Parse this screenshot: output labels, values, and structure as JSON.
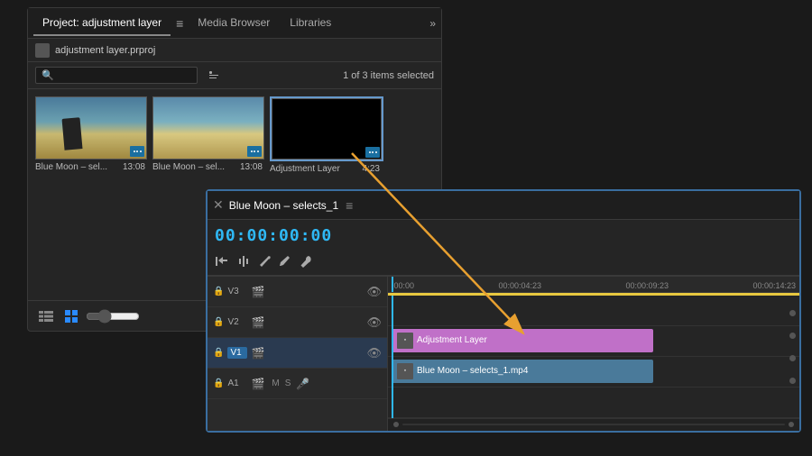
{
  "projectPanel": {
    "tabs": [
      {
        "label": "Project: adjustment layer",
        "active": true
      },
      {
        "label": "Media Browser",
        "active": false
      },
      {
        "label": "Libraries",
        "active": false
      }
    ],
    "moreLabel": "»",
    "menuIcon": "≡",
    "filename": "adjustment layer.prproj",
    "searchPlaceholder": "",
    "selectionInfo": "1 of 3 items selected",
    "mediaItems": [
      {
        "label": "Blue Moon – sel...",
        "duration": "13:08"
      },
      {
        "label": "Blue Moon – sel...",
        "duration": "13:08"
      },
      {
        "label": "Adjustment Layer",
        "duration": "4:23"
      }
    ],
    "bottomIcons": [
      "list-icon",
      "grid-icon",
      "zoom-icon",
      "expand-icon"
    ]
  },
  "timelinePanel": {
    "closeLabel": "✕",
    "tabLabel": "Blue Moon – selects_1",
    "menuIcon": "≡",
    "timecode": "00:00:00:00",
    "tracks": [
      {
        "label": "V3",
        "active": false
      },
      {
        "label": "V2",
        "active": false
      },
      {
        "label": "V1",
        "active": true
      },
      {
        "label": "A1",
        "active": false
      }
    ],
    "rulerMarks": [
      ":00:00",
      "00:00:04:23",
      "00:00:09:23",
      "00:00:14:23"
    ],
    "clips": [
      {
        "label": "Adjustment Layer",
        "track": "V2",
        "color": "purple"
      },
      {
        "label": "Blue Moon – selects_1.mp4",
        "track": "V1",
        "color": "blue"
      }
    ]
  },
  "arrow": {
    "visible": true
  }
}
